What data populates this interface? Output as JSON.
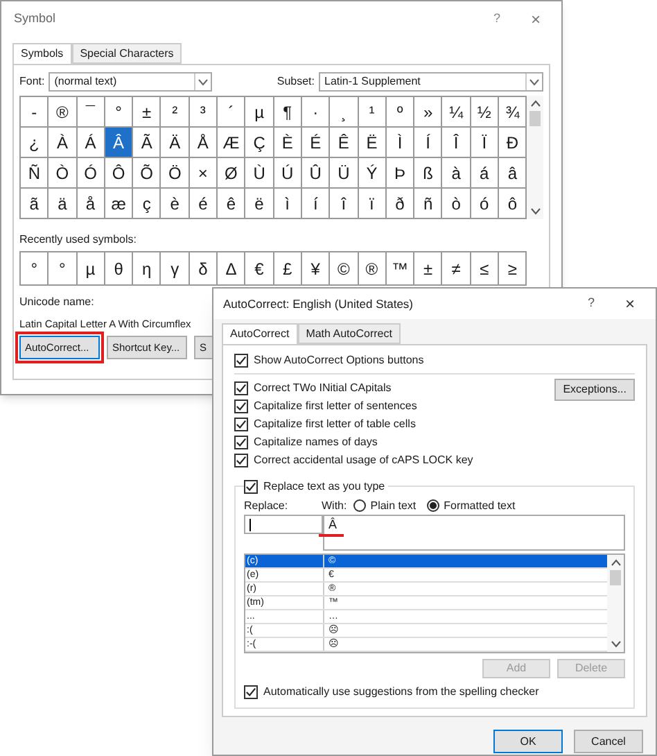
{
  "symbol_dialog": {
    "title": "Symbol",
    "help": "?",
    "close": "×",
    "tabs": [
      {
        "label": "Symbols",
        "selected": true
      },
      {
        "label": "Special Characters",
        "selected": false
      }
    ],
    "font": {
      "label": "Font:",
      "value": "(normal text)"
    },
    "subset": {
      "label": "Subset:",
      "value": "Latin-1 Supplement"
    },
    "grid": [
      {
        "cells": [
          {
            "char": "-",
            "selected": false
          },
          {
            "char": "®",
            "selected": false
          },
          {
            "char": "¯",
            "selected": false
          },
          {
            "char": "°",
            "selected": false
          },
          {
            "char": "±",
            "selected": false
          },
          {
            "char": "²",
            "selected": false
          },
          {
            "char": "³",
            "selected": false
          },
          {
            "char": "´",
            "selected": false
          },
          {
            "char": "µ",
            "selected": false
          },
          {
            "char": "¶",
            "selected": false
          },
          {
            "char": "·",
            "selected": false
          },
          {
            "char": "¸",
            "selected": false
          },
          {
            "char": "¹",
            "selected": false
          },
          {
            "char": "º",
            "selected": false
          },
          {
            "char": "»",
            "selected": false
          },
          {
            "char": "¼",
            "selected": false
          },
          {
            "char": "½",
            "selected": false
          },
          {
            "char": "¾",
            "selected": false
          }
        ]
      },
      {
        "cells": [
          {
            "char": "¿",
            "selected": false
          },
          {
            "char": "À",
            "selected": false
          },
          {
            "char": "Á",
            "selected": false
          },
          {
            "char": "Â",
            "selected": true
          },
          {
            "char": "Ã",
            "selected": false
          },
          {
            "char": "Ä",
            "selected": false
          },
          {
            "char": "Å",
            "selected": false
          },
          {
            "char": "Æ",
            "selected": false
          },
          {
            "char": "Ç",
            "selected": false
          },
          {
            "char": "È",
            "selected": false
          },
          {
            "char": "É",
            "selected": false
          },
          {
            "char": "Ê",
            "selected": false
          },
          {
            "char": "Ë",
            "selected": false
          },
          {
            "char": "Ì",
            "selected": false
          },
          {
            "char": "Í",
            "selected": false
          },
          {
            "char": "Î",
            "selected": false
          },
          {
            "char": "Ï",
            "selected": false
          },
          {
            "char": "Ð",
            "selected": false
          }
        ]
      },
      {
        "cells": [
          {
            "char": "Ñ",
            "selected": false
          },
          {
            "char": "Ò",
            "selected": false
          },
          {
            "char": "Ó",
            "selected": false
          },
          {
            "char": "Ô",
            "selected": false
          },
          {
            "char": "Õ",
            "selected": false
          },
          {
            "char": "Ö",
            "selected": false
          },
          {
            "char": "×",
            "selected": false
          },
          {
            "char": "Ø",
            "selected": false
          },
          {
            "char": "Ù",
            "selected": false
          },
          {
            "char": "Ú",
            "selected": false
          },
          {
            "char": "Û",
            "selected": false
          },
          {
            "char": "Ü",
            "selected": false
          },
          {
            "char": "Ý",
            "selected": false
          },
          {
            "char": "Þ",
            "selected": false
          },
          {
            "char": "ß",
            "selected": false
          },
          {
            "char": "à",
            "selected": false
          },
          {
            "char": "á",
            "selected": false
          },
          {
            "char": "â",
            "selected": false
          }
        ]
      },
      {
        "cells": [
          {
            "char": "ã",
            "selected": false
          },
          {
            "char": "ä",
            "selected": false
          },
          {
            "char": "å",
            "selected": false
          },
          {
            "char": "æ",
            "selected": false
          },
          {
            "char": "ç",
            "selected": false
          },
          {
            "char": "è",
            "selected": false
          },
          {
            "char": "é",
            "selected": false
          },
          {
            "char": "ê",
            "selected": false
          },
          {
            "char": "ë",
            "selected": false
          },
          {
            "char": "ì",
            "selected": false
          },
          {
            "char": "í",
            "selected": false
          },
          {
            "char": "î",
            "selected": false
          },
          {
            "char": "ï",
            "selected": false
          },
          {
            "char": "ð",
            "selected": false
          },
          {
            "char": "ñ",
            "selected": false
          },
          {
            "char": "ò",
            "selected": false
          },
          {
            "char": "ó",
            "selected": false
          },
          {
            "char": "ô",
            "selected": false
          }
        ]
      }
    ],
    "recently_used": {
      "label": "Recently used symbols:",
      "symbols": [
        "°",
        "°",
        "µ",
        "θ",
        "η",
        "γ",
        "δ",
        "Δ",
        "€",
        "£",
        "¥",
        "©",
        "®",
        "™",
        "±",
        "≠",
        "≤",
        "≥"
      ]
    },
    "unicode_name": {
      "label": "Unicode name:",
      "value": "Latin Capital Letter A With Circumflex"
    },
    "buttons": [
      {
        "label": "AutoCorrect...",
        "highlighted": true
      },
      {
        "label": "Shortcut Key...",
        "highlighted": false
      },
      {
        "label": "S",
        "highlighted": false
      }
    ]
  },
  "autocorrect_dialog": {
    "title": "AutoCorrect: English (United States)",
    "help": "?",
    "close": "×",
    "tabs": [
      {
        "label": "AutoCorrect",
        "selected": true
      },
      {
        "label": "Math AutoCorrect",
        "selected": false
      }
    ],
    "show_options": {
      "label": "Show AutoCorrect Options buttons",
      "checked": true
    },
    "options": [
      {
        "label": "Correct TWo INitial CApitals",
        "checked": true
      },
      {
        "label": "Capitalize first letter of sentences",
        "checked": true
      },
      {
        "label": "Capitalize first letter of table cells",
        "checked": true
      },
      {
        "label": "Capitalize names of days",
        "checked": true
      },
      {
        "label": "Correct accidental usage of cAPS LOCK key",
        "checked": true
      }
    ],
    "exceptions_button": "Exceptions...",
    "replace_as_you_type": {
      "label": "Replace text as you type",
      "checked": true
    },
    "replace_label": "Replace:",
    "with_label": "With:",
    "radios": [
      {
        "label": "Plain text",
        "selected": false
      },
      {
        "label": "Formatted text",
        "selected": true
      }
    ],
    "with_value": "Â",
    "entries": [
      {
        "replace": "(c)",
        "with": "©",
        "selected": true
      },
      {
        "replace": "(e)",
        "with": "€",
        "selected": false
      },
      {
        "replace": "(r)",
        "with": "®",
        "selected": false
      },
      {
        "replace": "(tm)",
        "with": "™",
        "selected": false
      },
      {
        "replace": "...",
        "with": "…",
        "selected": false
      },
      {
        "replace": ":(",
        "with": "☹",
        "selected": false
      },
      {
        "replace": ":-(",
        "with": "☹",
        "selected": false
      }
    ],
    "add_button": {
      "label": "Add",
      "disabled": true
    },
    "delete_button": {
      "label": "Delete",
      "disabled": true
    },
    "auto_suggest": {
      "label": "Automatically use suggestions from the spelling checker",
      "checked": true
    },
    "ok": "OK",
    "cancel": "Cancel"
  }
}
